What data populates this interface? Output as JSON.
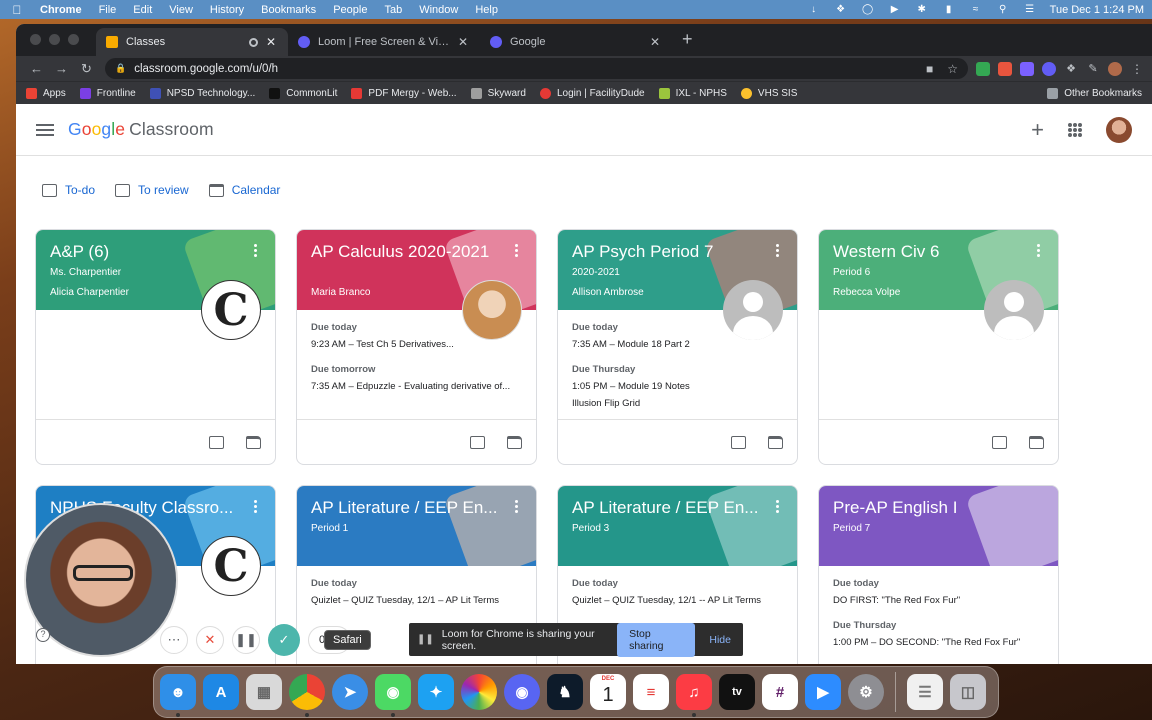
{
  "menubar": {
    "app": "Chrome",
    "menus": [
      "File",
      "Edit",
      "View",
      "History",
      "Bookmarks",
      "People",
      "Tab",
      "Window",
      "Help"
    ],
    "clock": "Tue Dec 1  1:24 PM"
  },
  "tabs": [
    {
      "title": "Classes",
      "color": "#f9ab00",
      "active": true
    },
    {
      "title": "Loom | Free Screen & Video Re",
      "color": "#625df5",
      "active": false
    },
    {
      "title": "Google",
      "color": "#625df5",
      "active": false
    }
  ],
  "omnibox": {
    "url": "classroom.google.com/u/0/h"
  },
  "bookmarks": [
    {
      "label": "Apps",
      "color": "#ea4335"
    },
    {
      "label": "Frontline",
      "color": "#7b3fe4"
    },
    {
      "label": "NPSD Technology...",
      "color": "#3f51b5"
    },
    {
      "label": "CommonLit",
      "color": "#111111"
    },
    {
      "label": "PDF Mergy - Web...",
      "color": "#e53935"
    },
    {
      "label": "Skyward",
      "color": "#9e9e9e"
    },
    {
      "label": "Login | FacilityDude",
      "color": "#e53935"
    },
    {
      "label": "IXL - NPHS",
      "color": "#9bc53d"
    },
    {
      "label": "VHS SIS",
      "color": "#fbc02d"
    }
  ],
  "other_bookmarks": "Other Bookmarks",
  "classroom": {
    "brand_letters": [
      "G",
      "o",
      "o",
      "g",
      "l",
      "e"
    ],
    "product": "Classroom",
    "nav": {
      "todo": "To-do",
      "review": "To review",
      "calendar": "Calendar"
    }
  },
  "cards": [
    {
      "title": "A&P (6)",
      "sub": "Ms. Charpentier",
      "teacher": "Alicia Charpentier",
      "color": "#2e9e7a",
      "avatar": "C",
      "due": []
    },
    {
      "title": "AP Calculus 2020-2021",
      "sub": "",
      "teacher": "Maria Branco",
      "color": "#d0335b",
      "avatar": "",
      "due": [
        {
          "label": "Due today",
          "item": "9:23 AM – Test Ch 5 Derivatives..."
        },
        {
          "label": "Due tomorrow",
          "item": "7:35 AM – Edpuzzle - Evaluating derivative of..."
        }
      ]
    },
    {
      "title": "AP Psych Period 7",
      "sub": "2020-2021",
      "teacher": "Allison Ambrose",
      "color": "#2e9e8a",
      "avatar": "",
      "due": [
        {
          "label": "Due today",
          "item": "7:35 AM – Module 18 Part 2"
        },
        {
          "label": "Due Thursday",
          "item": "1:05 PM – Module 19 Notes",
          "item2": "Illusion Flip Grid"
        }
      ]
    },
    {
      "title": "Western Civ 6",
      "sub": "Period 6",
      "teacher": "Rebecca Volpe",
      "color": "#4caf7a",
      "avatar": "",
      "due": []
    },
    {
      "title": "NPHS Faculty Classro...",
      "sub": "",
      "teacher": "",
      "color": "#1e7fc4",
      "avatar": "C",
      "due": []
    },
    {
      "title": "AP Literature / EEP En...",
      "sub": "Period 1",
      "teacher": "",
      "color": "#2b7bc2",
      "avatar": "",
      "due": [
        {
          "label": "Due today",
          "item": "Quizlet – QUIZ Tuesday, 12/1 – AP Lit Terms"
        }
      ]
    },
    {
      "title": "AP Literature / EEP En...",
      "sub": "Period 3",
      "teacher": "",
      "color": "#24968a",
      "avatar": "",
      "due": [
        {
          "label": "Due today",
          "item": "Quizlet – QUIZ Tuesday, 12/1 -- AP Lit Terms"
        }
      ]
    },
    {
      "title": "Pre-AP English I",
      "sub": "Period 7",
      "teacher": "",
      "color": "#7e57c2",
      "avatar": "",
      "due": [
        {
          "label": "Due today",
          "item": "DO FIRST: \"The Red Fox Fur\""
        },
        {
          "label": "Due Thursday",
          "item": "1:00 PM – DO SECOND: \"The Red Fox Fur\""
        }
      ]
    }
  ],
  "loom": {
    "timer": "0:00",
    "share_message": "Loom for Chrome is sharing your screen.",
    "stop_label": "Stop sharing",
    "hide_label": "Hide",
    "tooltip": "Safari"
  },
  "dock": {
    "calendar_month": "DEC",
    "calendar_day": "1",
    "apps": [
      {
        "name": "finder",
        "color": "#2f8fe8"
      },
      {
        "name": "app-store",
        "color": "#1e88e5"
      },
      {
        "name": "launchpad",
        "color": "#d9d9d9"
      },
      {
        "name": "chrome",
        "color": "#f1f1f1"
      },
      {
        "name": "safari",
        "color": "#3a8ee6"
      },
      {
        "name": "messages",
        "color": "#4cd964"
      },
      {
        "name": "twitter",
        "color": "#1da1f2"
      },
      {
        "name": "photos",
        "color": "#f5f5f5"
      },
      {
        "name": "discord",
        "color": "#5865f2"
      },
      {
        "name": "kindle",
        "color": "#0d1b2a"
      },
      {
        "name": "calendar",
        "color": "#ffffff"
      },
      {
        "name": "reminders",
        "color": "#ffffff"
      },
      {
        "name": "music",
        "color": "#fc3c44"
      },
      {
        "name": "apple-tv",
        "color": "#111111"
      },
      {
        "name": "slack",
        "color": "#ffffff"
      },
      {
        "name": "zoom",
        "color": "#2d8cff"
      },
      {
        "name": "system-preferences",
        "color": "#8e8e93"
      },
      {
        "name": "document-stack",
        "color": "#f0f0f0"
      },
      {
        "name": "trash",
        "color": "#c7c7cc"
      }
    ]
  }
}
